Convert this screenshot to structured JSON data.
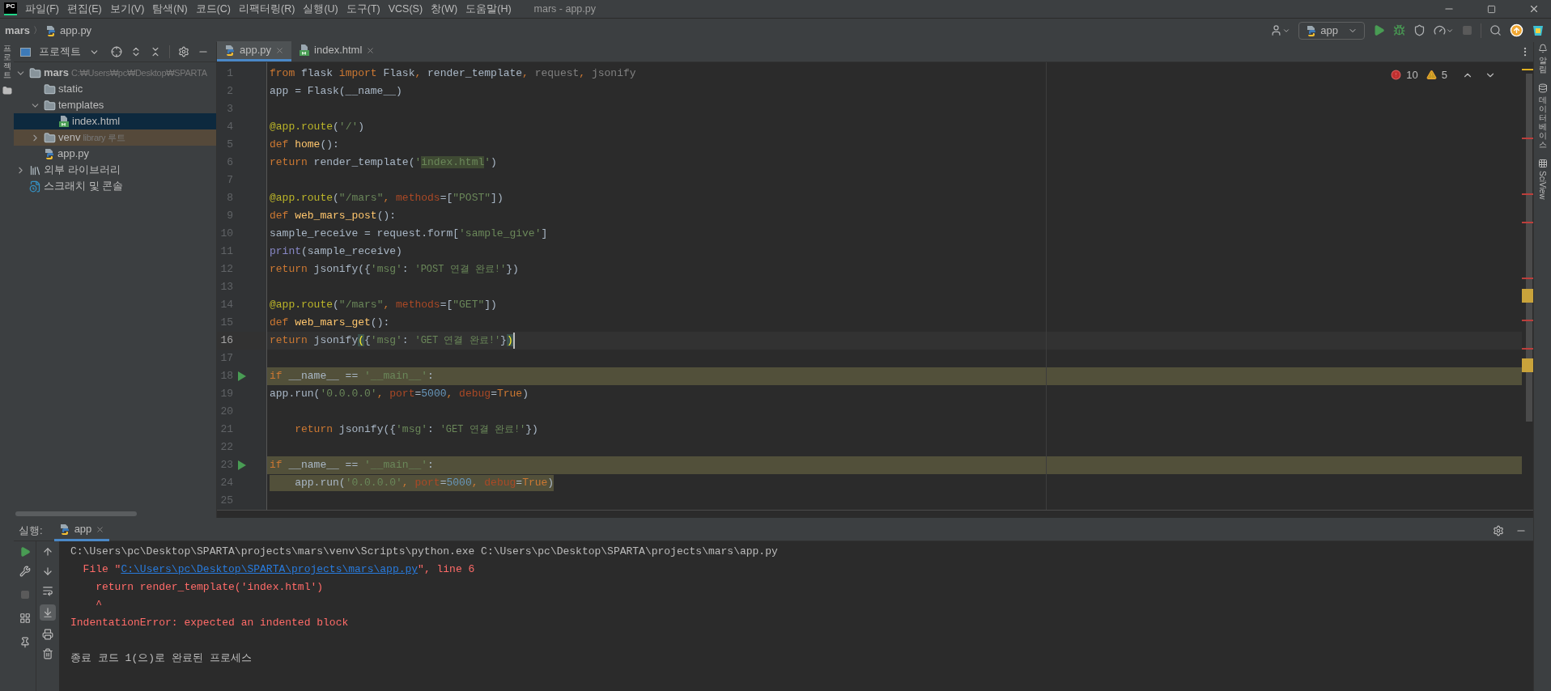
{
  "title_bar": {
    "logo": "PC",
    "menu": [
      "파일(F)",
      "편집(E)",
      "보기(V)",
      "탐색(N)",
      "코드(C)",
      "리팩터링(R)",
      "실행(U)",
      "도구(T)",
      "VCS(S)",
      "창(W)",
      "도움말(H)"
    ],
    "title": "mars - app.py"
  },
  "nav_bar": {
    "breadcrumbs": [
      {
        "label": "mars",
        "kind": "project"
      },
      {
        "label": "app.py",
        "kind": "python"
      }
    ],
    "separator": "〉",
    "run_config": "app"
  },
  "left_strip": {
    "label": "프로젝트"
  },
  "project_panel": {
    "title": "프로젝트",
    "tree": [
      {
        "label": "mars",
        "kind": "folder",
        "note": "C:₩Users₩pc₩Desktop₩SPARTA",
        "expanded": true,
        "selected": false,
        "highlighted": false,
        "children": [
          {
            "label": "static",
            "kind": "folder",
            "selected": false,
            "highlighted": false
          },
          {
            "label": "templates",
            "kind": "folder",
            "expanded": true,
            "selected": false,
            "highlighted": false,
            "children": [
              {
                "label": "index.html",
                "kind": "html",
                "selected": true,
                "highlighted": false
              }
            ]
          },
          {
            "label": "venv",
            "kind": "folder",
            "note": "library 루트",
            "expanded": false,
            "selected": false,
            "highlighted": true
          },
          {
            "label": "app.py",
            "kind": "python",
            "selected": false,
            "highlighted": false
          }
        ]
      },
      {
        "label": "외부 라이브러리",
        "kind": "libraries",
        "expanded": false,
        "selected": false,
        "highlighted": false
      },
      {
        "label": "스크래치 및 콘솔",
        "kind": "scratch",
        "selected": false,
        "highlighted": false
      }
    ]
  },
  "editor": {
    "tabs": [
      {
        "label": "app.py",
        "kind": "python",
        "selected": true
      },
      {
        "label": "index.html",
        "kind": "html",
        "selected": false
      }
    ],
    "errors": "10",
    "warnings": "5",
    "lines": [
      {
        "n": "1",
        "tokens": [
          {
            "kind": "kw",
            "t": "from"
          },
          {
            "kind": "plain",
            "t": " flask "
          },
          {
            "kind": "kw",
            "t": "import"
          },
          {
            "kind": "plain",
            "t": " Flask"
          },
          {
            "kind": "kw",
            "t": ", "
          },
          {
            "kind": "plain",
            "t": "render_template"
          },
          {
            "kind": "kw",
            "t": ", "
          },
          {
            "kind": "dim",
            "t": "request"
          },
          {
            "kind": "kw",
            "t": ", "
          },
          {
            "kind": "dim",
            "t": "jsonify"
          }
        ]
      },
      {
        "n": "2",
        "tokens": [
          {
            "kind": "plain",
            "t": "app = Flask(__name__)"
          }
        ]
      },
      {
        "n": "3"
      },
      {
        "n": "4",
        "tokens": [
          {
            "kind": "deco",
            "t": "@app.route"
          },
          {
            "kind": "plain",
            "t": "("
          },
          {
            "kind": "str",
            "t": "'/'"
          },
          {
            "kind": "plain",
            "t": ")"
          }
        ]
      },
      {
        "n": "5",
        "tokens": [
          {
            "kind": "kw",
            "t": "def "
          },
          {
            "kind": "fn",
            "t": "home"
          },
          {
            "kind": "plain",
            "t": "():"
          }
        ]
      },
      {
        "n": "6",
        "tokens": [
          {
            "kind": "kw",
            "t": "return "
          },
          {
            "kind": "plain",
            "t": "render_template("
          },
          {
            "kind": "str",
            "t": "'"
          },
          {
            "kind": "strsel",
            "t": "index.html"
          },
          {
            "kind": "str",
            "t": "'"
          },
          {
            "kind": "plain",
            "t": ")"
          }
        ]
      },
      {
        "n": "7"
      },
      {
        "n": "8",
        "tokens": [
          {
            "kind": "deco",
            "t": "@app.route"
          },
          {
            "kind": "plain",
            "t": "("
          },
          {
            "kind": "str",
            "t": "\"/mars\""
          },
          {
            "kind": "kw",
            "t": ", "
          },
          {
            "kind": "param",
            "t": "methods"
          },
          {
            "kind": "plain",
            "t": "=["
          },
          {
            "kind": "str",
            "t": "\"POST\""
          },
          {
            "kind": "plain",
            "t": "])"
          }
        ]
      },
      {
        "n": "9",
        "tokens": [
          {
            "kind": "kw",
            "t": "def "
          },
          {
            "kind": "fn",
            "t": "web_mars_post"
          },
          {
            "kind": "plain",
            "t": "():"
          }
        ]
      },
      {
        "n": "10",
        "tokens": [
          {
            "kind": "plain",
            "t": "sample_receive = request.form["
          },
          {
            "kind": "str",
            "t": "'sample_give'"
          },
          {
            "kind": "plain",
            "t": "]"
          }
        ]
      },
      {
        "n": "11",
        "tokens": [
          {
            "kind": "builtin",
            "t": "print"
          },
          {
            "kind": "plain",
            "t": "(sample_receive)"
          }
        ]
      },
      {
        "n": "12",
        "tokens": [
          {
            "kind": "kw",
            "t": "return "
          },
          {
            "kind": "plain",
            "t": "jsonify({"
          },
          {
            "kind": "str",
            "t": "'msg'"
          },
          {
            "kind": "plain",
            "t": ": "
          },
          {
            "kind": "str",
            "t": "'POST 연결 완료!'"
          },
          {
            "kind": "plain",
            "t": "})"
          }
        ]
      },
      {
        "n": "13"
      },
      {
        "n": "14",
        "tokens": [
          {
            "kind": "deco",
            "t": "@app.route"
          },
          {
            "kind": "plain",
            "t": "("
          },
          {
            "kind": "str",
            "t": "\"/mars\""
          },
          {
            "kind": "kw",
            "t": ", "
          },
          {
            "kind": "param",
            "t": "methods"
          },
          {
            "kind": "plain",
            "t": "=["
          },
          {
            "kind": "str",
            "t": "\"GET\""
          },
          {
            "kind": "plain",
            "t": "])"
          }
        ]
      },
      {
        "n": "15",
        "tokens": [
          {
            "kind": "kw",
            "t": "def "
          },
          {
            "kind": "fn",
            "t": "web_mars_get"
          },
          {
            "kind": "plain",
            "t": "():"
          }
        ]
      },
      {
        "n": "16",
        "kind": "current",
        "tokens": [
          {
            "kind": "kw",
            "t": "return "
          },
          {
            "kind": "plain",
            "t": "jsonify"
          },
          {
            "kind": "match",
            "t": "("
          },
          {
            "kind": "plain",
            "t": "{"
          },
          {
            "kind": "str",
            "t": "'msg'"
          },
          {
            "kind": "plain",
            "t": ": "
          },
          {
            "kind": "str",
            "t": "'GET 연결 완료!'"
          },
          {
            "kind": "plain",
            "t": "}"
          },
          {
            "kind": "match",
            "t": ")"
          }
        ]
      },
      {
        "n": "17"
      },
      {
        "n": "18",
        "kind": "highlighted",
        "run_marker": true,
        "tokens": [
          {
            "kind": "kw",
            "t": "if "
          },
          {
            "kind": "plain",
            "t": "__name__ == "
          },
          {
            "kind": "str",
            "t": "'__main__'"
          },
          {
            "kind": "plain",
            "t": ":"
          }
        ]
      },
      {
        "n": "19",
        "tokens": [
          {
            "kind": "plain",
            "t": "app.run("
          },
          {
            "kind": "str",
            "t": "'0.0.0.0'"
          },
          {
            "kind": "kw",
            "t": ", "
          },
          {
            "kind": "param",
            "t": "port"
          },
          {
            "kind": "plain",
            "t": "="
          },
          {
            "kind": "num",
            "t": "5000"
          },
          {
            "kind": "kw",
            "t": ", "
          },
          {
            "kind": "param",
            "t": "debug"
          },
          {
            "kind": "plain",
            "t": "="
          },
          {
            "kind": "kw",
            "t": "True"
          },
          {
            "kind": "plain",
            "t": ")"
          }
        ]
      },
      {
        "n": "20"
      },
      {
        "n": "21",
        "tokens": [
          {
            "kind": "kw",
            "t": "    return "
          },
          {
            "kind": "plain",
            "t": "jsonify({"
          },
          {
            "kind": "str",
            "t": "'msg'"
          },
          {
            "kind": "plain",
            "t": ": "
          },
          {
            "kind": "str",
            "t": "'GET 연결 완료!'"
          },
          {
            "kind": "plain",
            "t": "})"
          }
        ]
      },
      {
        "n": "22"
      },
      {
        "n": "23",
        "kind": "highlighted",
        "run_marker": true,
        "tokens": [
          {
            "kind": "kw",
            "t": "if "
          },
          {
            "kind": "plain",
            "t": "__name__ == "
          },
          {
            "kind": "str",
            "t": "'__main__'"
          },
          {
            "kind": "plain",
            "t": ":"
          }
        ]
      },
      {
        "n": "24",
        "kind": "selected_text",
        "tokens": [
          {
            "kind": "plain",
            "t": "    app.run("
          },
          {
            "kind": "str",
            "t": "'0.0.0.0'"
          },
          {
            "kind": "kw",
            "t": ", "
          },
          {
            "kind": "param",
            "t": "port"
          },
          {
            "kind": "plain",
            "t": "="
          },
          {
            "kind": "num",
            "t": "5000"
          },
          {
            "kind": "kw",
            "t": ", "
          },
          {
            "kind": "param",
            "t": "debug"
          },
          {
            "kind": "plain",
            "t": "="
          },
          {
            "kind": "kw",
            "t": "True"
          },
          {
            "kind": "plain",
            "t": ")"
          }
        ]
      },
      {
        "n": "25"
      }
    ]
  },
  "right_strip": [
    {
      "label": "알림",
      "kind": "bell"
    },
    {
      "label": "데이터베이스",
      "kind": "database"
    },
    {
      "label": "SciView",
      "kind": "grid"
    }
  ],
  "run_panel": {
    "label": "실행:",
    "tab": "app",
    "output": [
      {
        "kind": "text",
        "segments": [
          {
            "kind": "plain",
            "t": "C:\\Users\\pc\\Desktop\\SPARTA\\projects\\mars\\venv\\Scripts\\python.exe C:\\Users\\pc\\Desktop\\SPARTA\\projects\\mars\\app.py"
          }
        ]
      },
      {
        "kind": "text",
        "segments": [
          {
            "kind": "error",
            "t": "  File \""
          },
          {
            "kind": "link",
            "t": "C:\\Users\\pc\\Desktop\\SPARTA\\projects\\mars\\app.py"
          },
          {
            "kind": "error",
            "t": "\", line 6"
          }
        ]
      },
      {
        "kind": "text",
        "segments": [
          {
            "kind": "error",
            "t": "    return render_template('index.html')"
          }
        ]
      },
      {
        "kind": "text",
        "segments": [
          {
            "kind": "error",
            "t": "    ^"
          }
        ]
      },
      {
        "kind": "text",
        "segments": [
          {
            "kind": "error",
            "t": "IndentationError: expected an indented block"
          }
        ]
      },
      {
        "kind": "blank"
      },
      {
        "kind": "text",
        "segments": [
          {
            "kind": "plain",
            "t": "종료 코드 1(으)로 완료된 프로세스"
          }
        ]
      }
    ]
  }
}
